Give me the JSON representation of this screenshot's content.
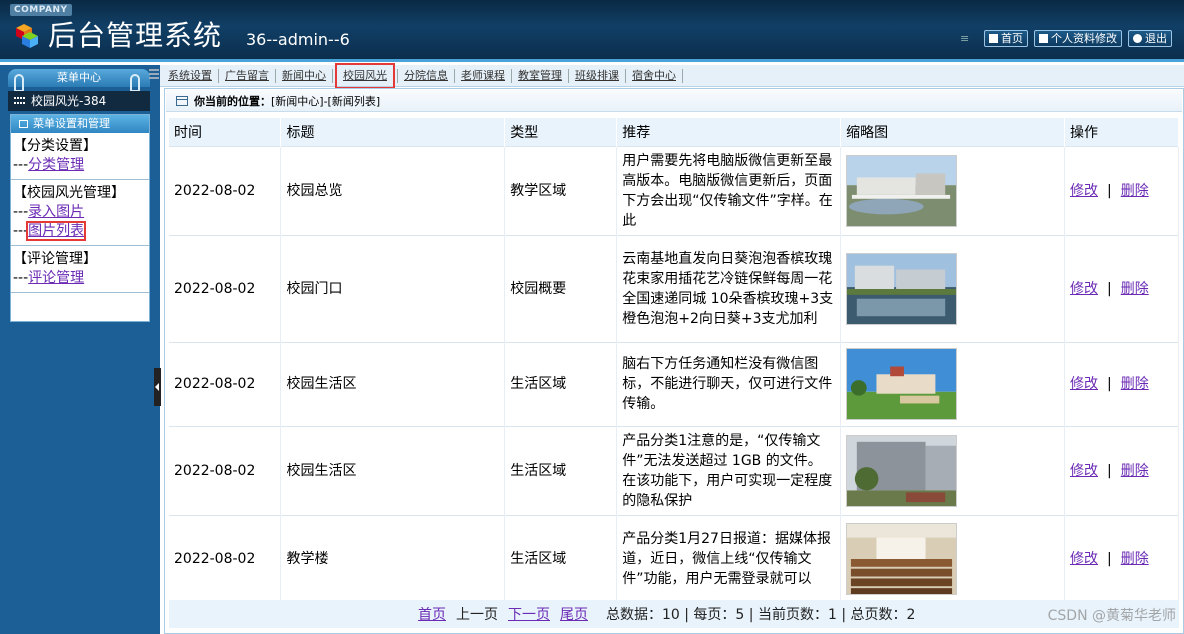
{
  "header": {
    "company_badge": "COMPANY",
    "title": "后台管理系统",
    "user_info": "36--admin--6",
    "buttons": [
      {
        "label": "首页",
        "icon": "home-icon"
      },
      {
        "label": "个人资料修改",
        "icon": "profile-icon"
      },
      {
        "label": "退出",
        "icon": "power-icon"
      }
    ]
  },
  "sidebar": {
    "menu_center": "菜单中心",
    "current_section": "校园风光-384",
    "box_title": "菜单设置和管理",
    "groups": [
      {
        "title": "【分类设置】",
        "links": [
          {
            "prefix": "---",
            "label": "分类管理"
          }
        ]
      },
      {
        "title": "【校园风光管理】",
        "links": [
          {
            "prefix": "---",
            "label": "录入图片"
          },
          {
            "prefix": "---",
            "label": "图片列表"
          }
        ]
      },
      {
        "title": "【评论管理】",
        "links": [
          {
            "prefix": "---",
            "label": "评论管理"
          }
        ]
      }
    ]
  },
  "topnav": {
    "items": [
      "系统设置",
      "广告留言",
      "新闻中心",
      "校园风光",
      "分院信息",
      "老师课程",
      "教室管理",
      "班级排课",
      "宿舍中心"
    ],
    "active": "校园风光"
  },
  "location": {
    "label": "你当前的位置：",
    "path": "[新闻中心]-[新闻列表]"
  },
  "table": {
    "columns": [
      "时间",
      "标题",
      "类型",
      "推荐",
      "缩略图",
      "操作"
    ],
    "rows": [
      {
        "time": "2022-08-02",
        "title": "校园总览",
        "type": "教学区域",
        "recommend": "用户需要先将电脑版微信更新至最高版本。电脑版微信更新后，页面下方会出现“仅传输文件”字样。在此",
        "edit": "修改",
        "delete": "删除"
      },
      {
        "time": "2022-08-02",
        "title": "校园门口",
        "type": "校园概要",
        "recommend": "云南基地直发向日葵泡泡香槟玫瑰花束家用插花艺冷链保鲜每周一花全国速递同城 10朵香槟玫瑰+3支橙色泡泡+2向日葵+3支尤加利",
        "edit": "修改",
        "delete": "删除"
      },
      {
        "time": "2022-08-02",
        "title": "校园生活区",
        "type": "生活区域",
        "recommend": "脑右下方任务通知栏没有微信图标，不能进行聊天，仅可进行文件传输。",
        "edit": "修改",
        "delete": "删除"
      },
      {
        "time": "2022-08-02",
        "title": "校园生活区",
        "type": "生活区域",
        "recommend": "产品分类1注意的是，“仅传输文件”无法发送超过 1GB 的文件。在该功能下，用户可实现一定程度的隐私保护",
        "edit": "修改",
        "delete": "删除"
      },
      {
        "time": "2022-08-02",
        "title": "教学楼",
        "type": "生活区域",
        "recommend": "产品分类1月27日报道：据媒体报道，近日，微信上线“仅传输文件”功能，用户无需登录就可以",
        "edit": "修改",
        "delete": "删除"
      }
    ]
  },
  "pager": {
    "first": "首页",
    "prev": "上一页",
    "next": "下一页",
    "last": "尾页",
    "stats": "总数据：10 | 每页：5 | 当前页数：1 | 总页数：2"
  },
  "watermark": "CSDN @黄菊华老师",
  "colors": {
    "header_bg": "#0b2e4d",
    "sidebar_bg": "#1c5f97",
    "link": "#6b2bb5",
    "highlight": "#e53935",
    "table_head_bg": "#e8f3fb"
  }
}
